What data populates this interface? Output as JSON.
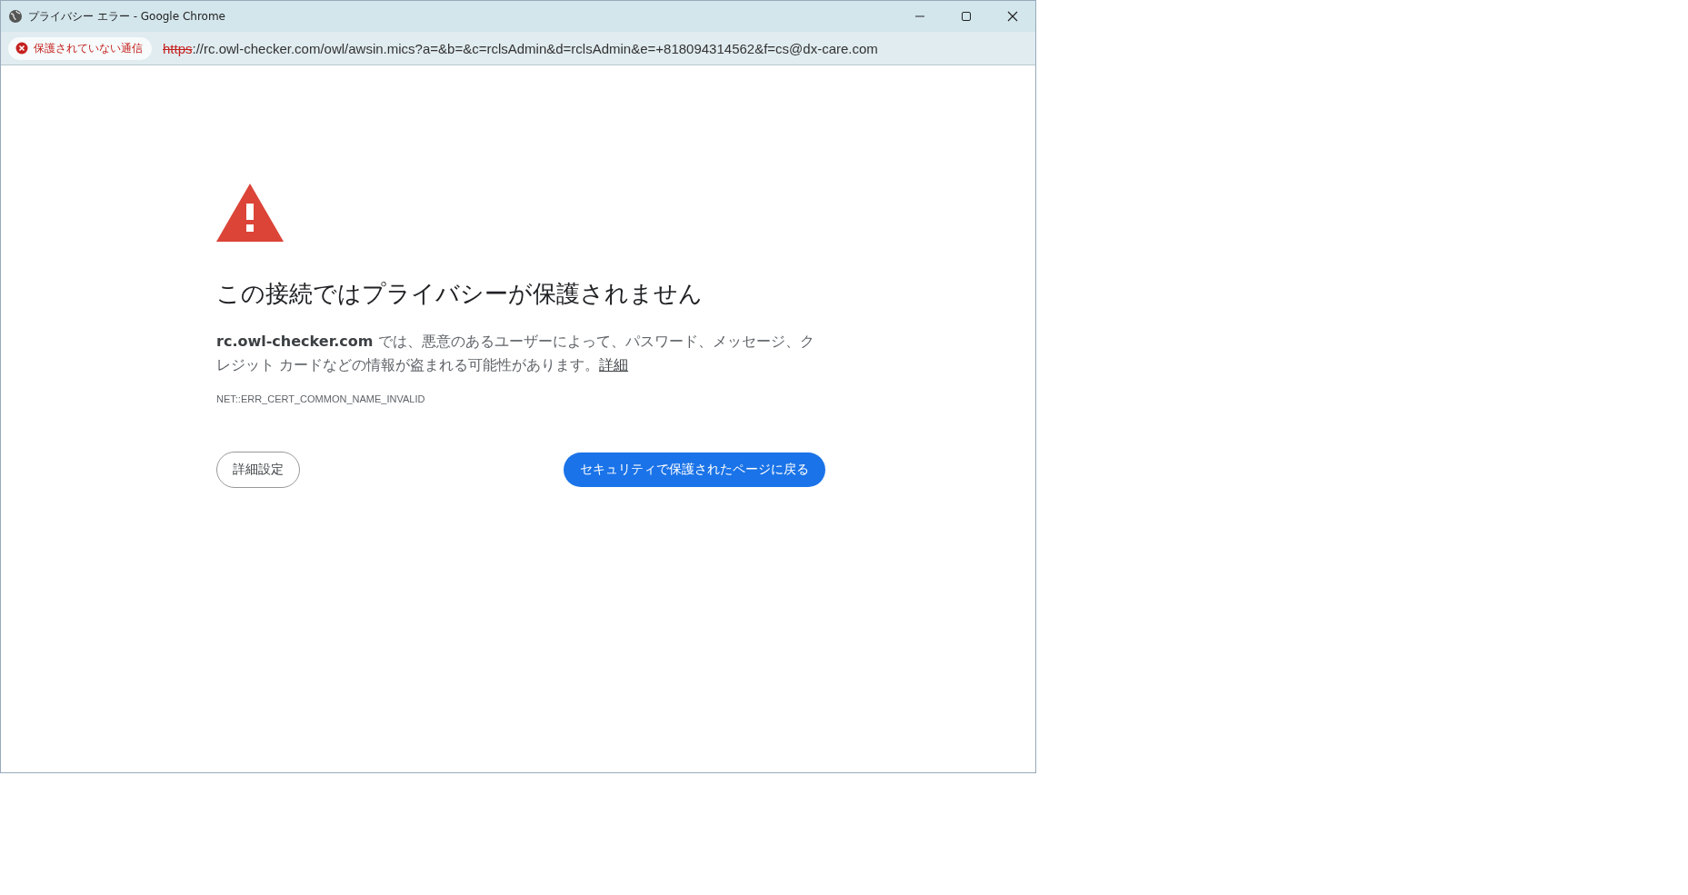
{
  "window": {
    "title": "プライバシー エラー - Google Chrome"
  },
  "address_bar": {
    "security_badge": "保護されていない通信",
    "url_scheme": "https",
    "url_rest": "://rc.owl-checker.com/owl/awsin.mics?a=&b=&c=rclsAdmin&d=rclsAdmin&e=+818094314562&f=cs@dx-care.com"
  },
  "page": {
    "heading": "この接続ではプライバシーが保護されません",
    "description": "**rc.owl-checker.com** では、悪意のあるユーザーによって、パスワード、メッセージ、クレジット カードなどの情報が盗まれる可能性があります。",
    "details_link": "詳細",
    "error_code": "NET::ERR_CERT_COMMON_NAME_INVALID",
    "advanced_button": "詳細設定",
    "back_button": "セキュリティで保護されたページに戻る"
  }
}
